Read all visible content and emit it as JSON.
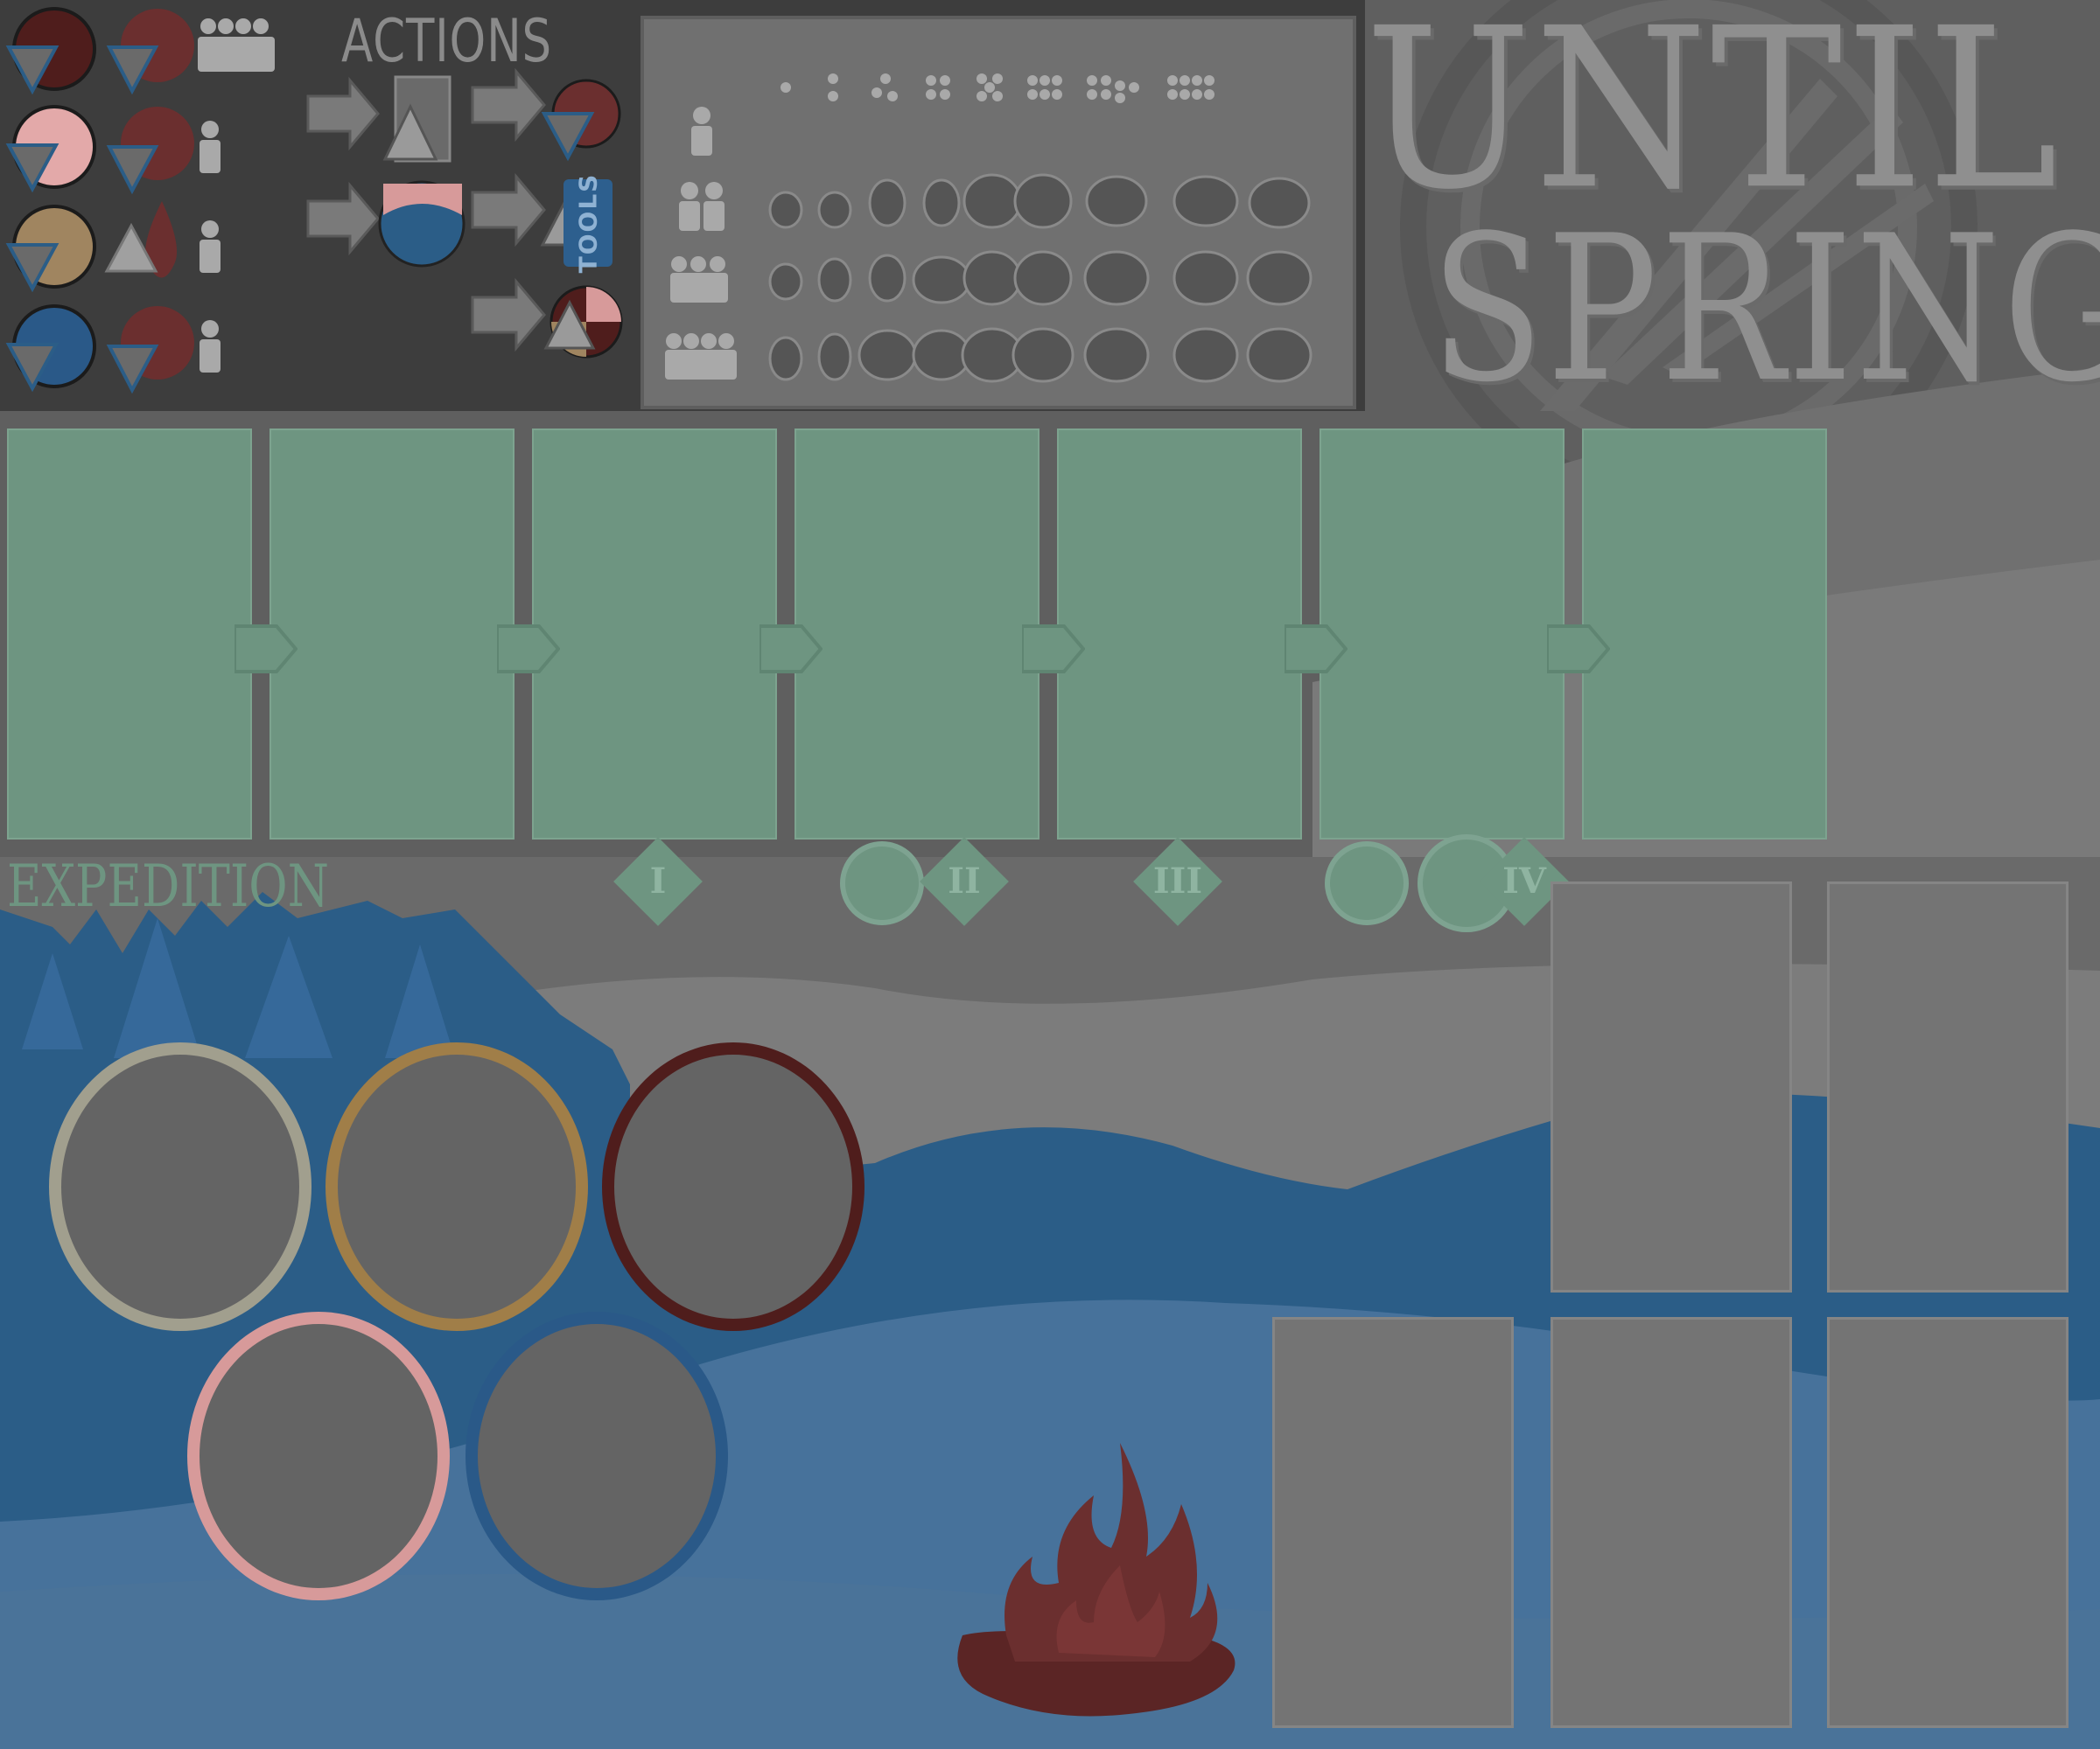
{
  "title": {
    "line1": "UNTIL",
    "line2": "SPRING"
  },
  "actions_label": "ACTIONS",
  "expedition_label": "EXPEDITION",
  "tools_label": "TOOLS",
  "stage_markers": [
    "I",
    "II",
    "III",
    "IV"
  ],
  "expedition_slots": 7,
  "colors": {
    "board_dark": "#3d3d3d",
    "slot_green": "#6e9581",
    "forest_blue": "#2b5d87",
    "lake_blue": "#47729b",
    "fire_red": "#6b2f2f",
    "ring_grey": "#a19f8e",
    "ring_gold": "#a07e48",
    "ring_maroon": "#4f1d1c",
    "ring_pink": "#d79a9a",
    "ring_blue": "#2a5988"
  },
  "icons": [
    "dark-red-token-icon",
    "pink-token-icon",
    "tan-token-icon",
    "blue-token-icon",
    "meat-icon",
    "blood-drop-icon",
    "person-icon",
    "arrow-icon",
    "tools-icon",
    "campfire-icon",
    "torch-icon"
  ]
}
